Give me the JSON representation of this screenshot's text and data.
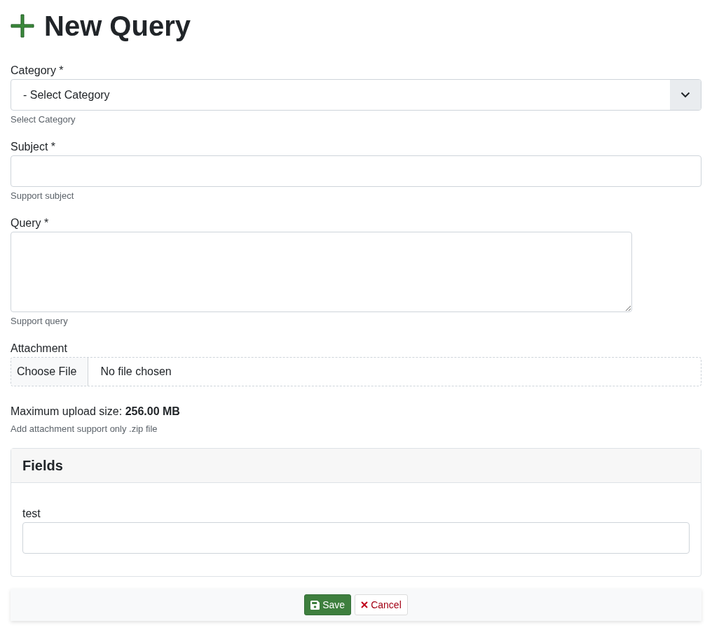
{
  "page": {
    "title": "New Query"
  },
  "form": {
    "fields": [
      {
        "kind": "select",
        "label": "Category *",
        "value": "- Select Category",
        "help": "Select Category"
      },
      {
        "kind": "text",
        "label": "Subject *",
        "help": "Support subject"
      },
      {
        "kind": "textarea",
        "label": "Query *",
        "help": "Support query"
      },
      {
        "kind": "file",
        "label": "Attachment",
        "button": "Choose File",
        "status": "No file chosen"
      }
    ],
    "upload_note": "Maximum upload size: **256.00 MB**",
    "attachment_help": "Add attachment support only .zip file"
  },
  "fields_panel": {
    "title": "Fields",
    "fields": [
      {
        "kind": "text",
        "label": "test"
      }
    ]
  },
  "actions": [
    {
      "kind": "primary",
      "label": "Save"
    },
    {
      "kind": "cancel",
      "label": "Cancel"
    }
  ]
}
